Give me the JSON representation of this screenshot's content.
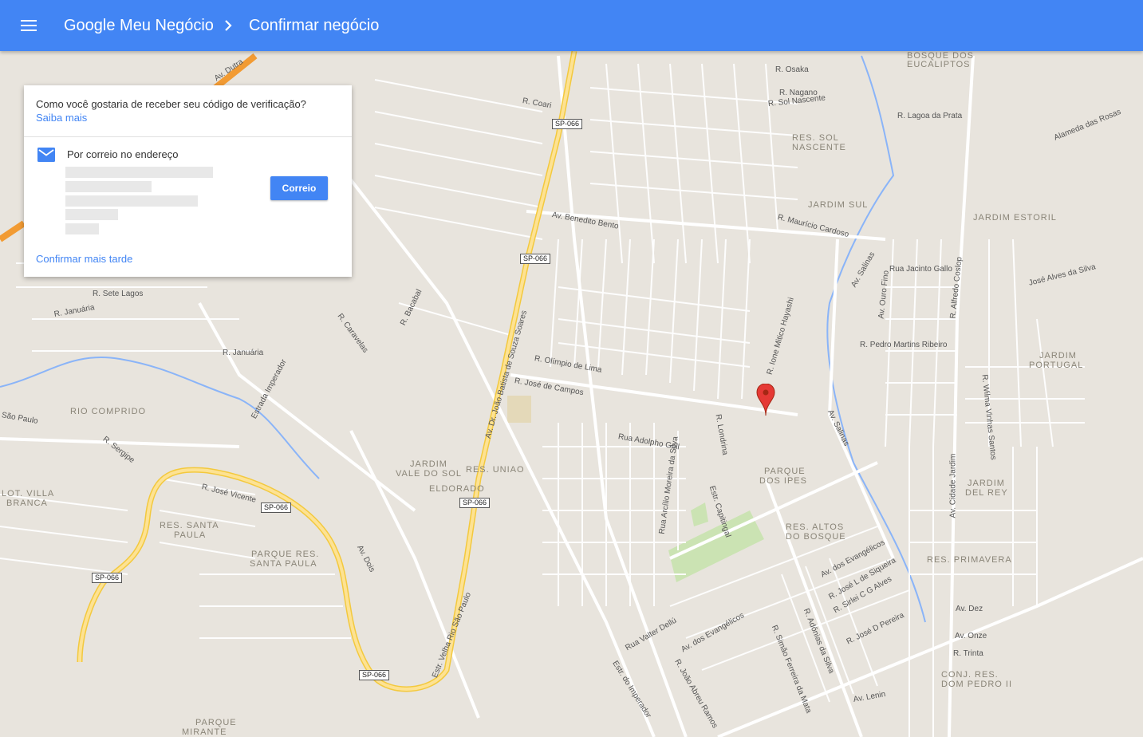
{
  "appbar": {
    "menu_icon": "hamburger-menu-icon",
    "crumb_1": "Google Meu Negócio",
    "crumb_sep_icon": "chevron-right-icon",
    "crumb_2": "Confirmar negócio",
    "color": "#4285f4"
  },
  "card": {
    "question": "Como você gostaria de receber seu código de verificação?",
    "learn_more": "Saiba mais",
    "option_icon": "mail-envelope-icon",
    "option_label": "Por correio no endereço",
    "mail_button": "Correio",
    "later_link": "Confirmar mais tarde"
  },
  "map": {
    "pin_icon": "map-marker-icon",
    "shields": [
      "SP-066",
      "SP-066",
      "SP-066",
      "SP-066",
      "SP-066",
      "SP-066"
    ],
    "area_labels": [
      "BOSQUE DOS",
      "EUCALIPTOS",
      "RES. SOL",
      "NASCENTE",
      "JARDIM SUL",
      "JARDIM ESTORIL",
      "JARDIM",
      "PORTUGAL",
      "RIO COMPRIDO",
      "JARDIM",
      "VALE DO SOL",
      "RES. UNIAO",
      "ELDORADO",
      "LOT. VILLA",
      "BRANCA",
      "RES. SANTA",
      "PAULA",
      "PARQUE RES.",
      "SANTA PAULA",
      "PARQUE",
      "DOS IPES",
      "RES. ALTOS",
      "DO BOSQUE",
      "JARDIM",
      "DEL REY",
      "RES. PRIMAVERA",
      "CONJ. RES.",
      "DOM PEDRO II",
      "PARQUE",
      "MIRANTE"
    ],
    "street_labels": [
      "Av. Benedito Bento",
      "R. Maurício Cardoso",
      "Rua Jacinto Gallo",
      "R. Pedro Martins Ribeiro",
      "R. Olímpio de Lima",
      "R. José de Campos",
      "Rua Adolpho Goll",
      "R. Sete Lagos",
      "R. Januária",
      "R. Januária",
      "Estrada Imperador",
      "R. José Vicente",
      "R. Sergipe",
      "Av. Dois",
      "Estr. Velha Rio São Paulo",
      "Av. Dr. João Batista de Souza Soares",
      "Rua Valter Dellú",
      "Av. dos Evangélicos",
      "Av. dos Evangélicos",
      "R. João Abreu Ramos",
      "Estr. do Imperador",
      "R. Adônias da Silva",
      "R. Simão Ferreira da Mata",
      "Av. Lenin",
      "R. Trinta",
      "Av. Onze",
      "Av. Dez",
      "Av. Cidade Jardim",
      "Av. Salinas",
      "Av. Salinas",
      "R. Lagoa da Prata",
      "R. Sol Nascente",
      "R. Osaka",
      "R. Nagano",
      "José Alves da Silva",
      "Alameda das Rosas",
      "Estr. Capitingal",
      "R. Londrina",
      "R. Ione Mitico Hayashi",
      "R. Coari",
      "São Paulo",
      "R. Caravelas",
      "R. Bacabal",
      "Rua Arcílio Moreira da Silva",
      "R. José D Pereira",
      "R. José L de Siqueira",
      "R. Sirlei C G Alves",
      "Av. Ouro Fino",
      "R. Alfredo Coslop",
      "R. Wilma Vinhas Santos",
      "Av. Dutra"
    ]
  }
}
